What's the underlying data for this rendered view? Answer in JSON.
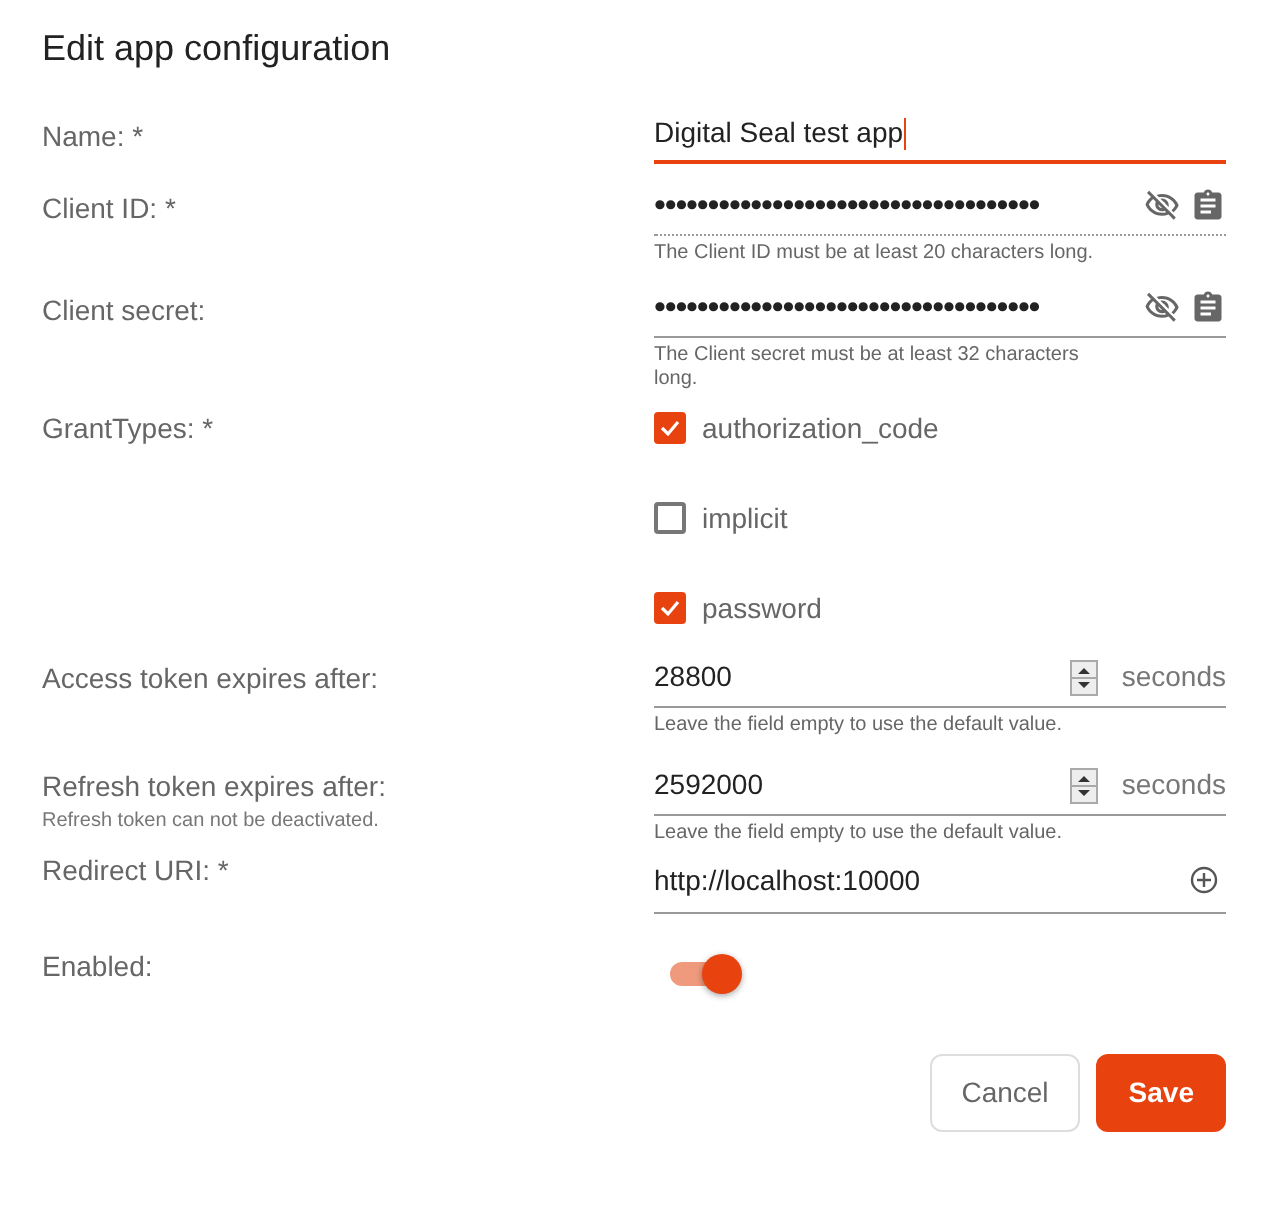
{
  "title": "Edit app configuration",
  "fields": [
    {
      "kind": "text",
      "label": "Name: *",
      "value": "Digital Seal test app",
      "focused": true
    },
    {
      "kind": "secret",
      "label": "Client ID: *",
      "value": "••••••••••••••••••••••••••••••••••••",
      "readonly": true,
      "hint": "The Client ID must be at least 20 characters long."
    },
    {
      "kind": "secret",
      "label": "Client secret:",
      "value": "••••••••••••••••••••••••••••••••••••",
      "readonly": false,
      "hint": "The Client secret must be at least 32 characters long."
    },
    {
      "kind": "checks",
      "label": "GrantTypes: *",
      "options": [
        {
          "label": "authorization_code",
          "checked": true
        },
        {
          "label": "implicit",
          "checked": false
        },
        {
          "label": "password",
          "checked": true
        }
      ]
    },
    {
      "kind": "number",
      "label": "Access token expires after:",
      "value": "28800",
      "unit": "seconds",
      "hint": "Leave the field empty to use the default value."
    },
    {
      "kind": "number",
      "label": "Refresh token expires after:",
      "note": "Refresh token can not be deactivated.",
      "value": "2592000",
      "unit": "seconds",
      "hint": "Leave the field empty to use the default value."
    },
    {
      "kind": "uri",
      "label": "Redirect URI: *",
      "value": "http://localhost:10000"
    },
    {
      "kind": "toggle",
      "label": "Enabled:",
      "on": true
    }
  ],
  "buttons": [
    {
      "label": "Cancel",
      "kind": "secondary"
    },
    {
      "label": "Save",
      "kind": "primary"
    }
  ]
}
